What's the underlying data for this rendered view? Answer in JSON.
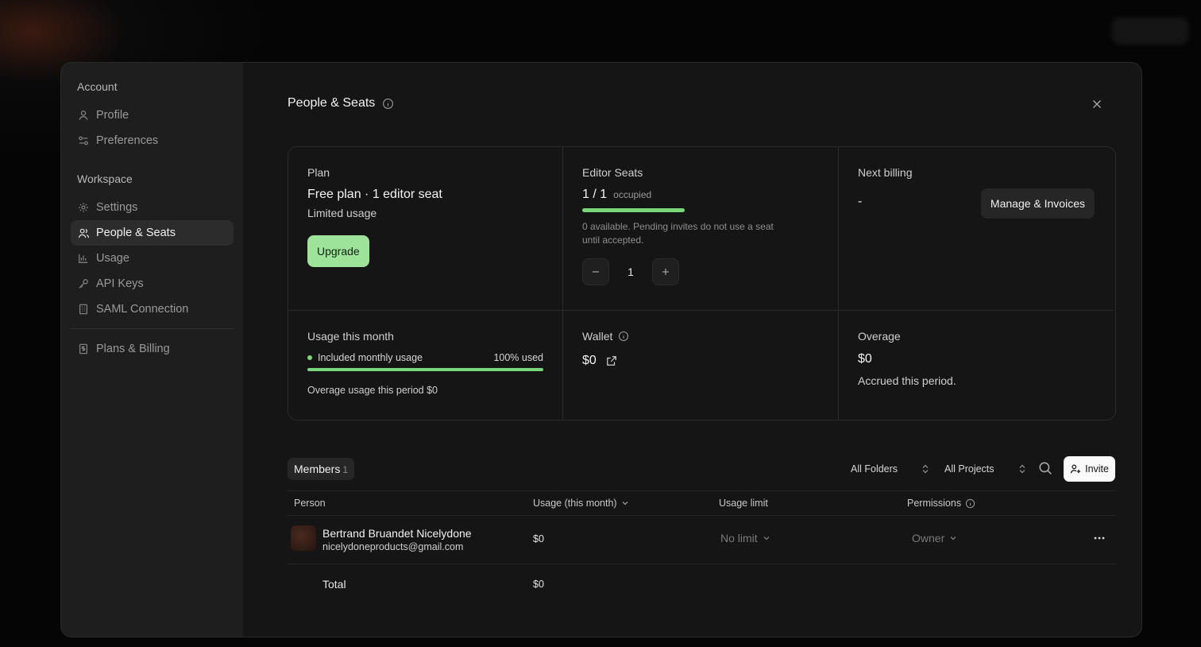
{
  "sidebar": {
    "account_heading": "Account",
    "workspace_heading": "Workspace",
    "items": [
      {
        "label": "Profile",
        "icon": "user-icon"
      },
      {
        "label": "Preferences",
        "icon": "sliders-icon"
      },
      {
        "label": "Settings",
        "icon": "gear-icon"
      },
      {
        "label": "People & Seats",
        "icon": "users-icon",
        "active": true
      },
      {
        "label": "Usage",
        "icon": "bar-chart-icon"
      },
      {
        "label": "API Keys",
        "icon": "key-icon"
      },
      {
        "label": "SAML Connection",
        "icon": "building-icon"
      },
      {
        "label": "Plans & Billing",
        "icon": "receipt-icon"
      }
    ]
  },
  "page": {
    "title": "People & Seats"
  },
  "plan": {
    "label": "Plan",
    "name": "Free plan · 1 editor seat",
    "limit": "Limited usage",
    "upgrade_label": "Upgrade",
    "upgrade_color": "#9ee39a"
  },
  "seats": {
    "label": "Editor Seats",
    "value": "1 / 1",
    "occupied_word": "occupied",
    "occupied_fraction": 1.0,
    "note": "0 available. Pending invites do not use a seat until accepted.",
    "stepper_value": "1"
  },
  "billing": {
    "label": "Next billing",
    "value": "-",
    "manage_label": "Manage & Invoices"
  },
  "usage": {
    "label": "Usage this month",
    "included_label": "Included monthly usage",
    "percent_text": "100% used",
    "used_fraction": 1.0,
    "overage_line": "Overage usage this period $0"
  },
  "wallet": {
    "label": "Wallet",
    "amount": "$0"
  },
  "overage": {
    "label": "Overage",
    "amount": "$0",
    "note": "Accrued this period."
  },
  "members": {
    "tab_label": "Members",
    "count": "1",
    "folders_filter": "All Folders",
    "projects_filter": "All Projects",
    "invite_label": "Invite",
    "columns": {
      "person": "Person",
      "usage": "Usage (this month)",
      "limit": "Usage limit",
      "permissions": "Permissions"
    },
    "rows": [
      {
        "name": "Bertrand Bruandet Nicelydone",
        "email": "nicelydoneproducts@gmail.com",
        "usage": "$0",
        "limit": "No limit",
        "permission": "Owner"
      }
    ],
    "total_label": "Total",
    "total_value": "$0"
  },
  "colors": {
    "accent_green": "#7ad67a",
    "bg": "#151515",
    "sidebar_bg": "#1e1e1e"
  }
}
